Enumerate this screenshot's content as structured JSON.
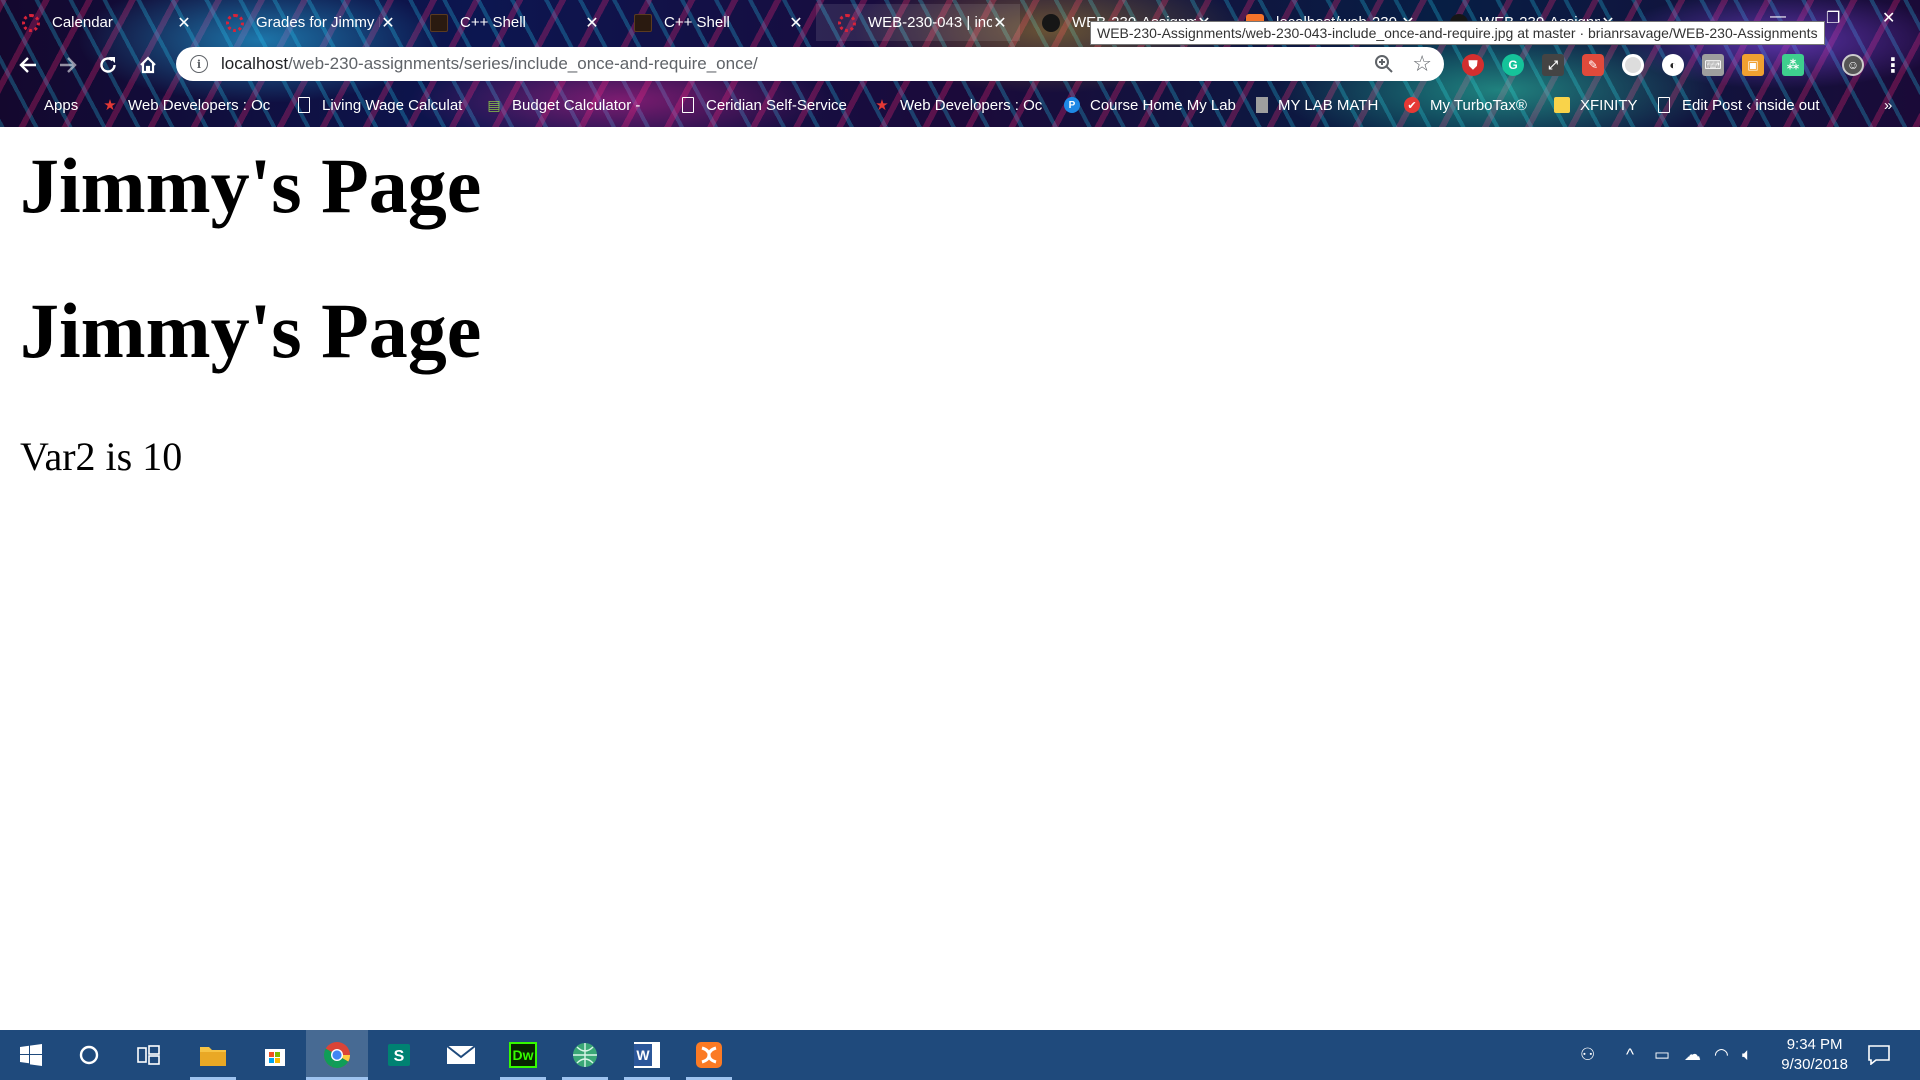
{
  "browser": {
    "tabs": [
      {
        "title": "Calendar",
        "icon": "ring-logo-icon",
        "active": false
      },
      {
        "title": "Grades for Jimmy I",
        "icon": "ring-logo-icon",
        "active": false
      },
      {
        "title": "C++ Shell",
        "icon": "cpp-shell-icon",
        "active": false
      },
      {
        "title": "C++ Shell",
        "icon": "cpp-shell-icon",
        "active": false
      },
      {
        "title": "WEB-230-043 | inc",
        "icon": "ring-logo-icon",
        "active": true
      },
      {
        "title": "WEB-230-Assignm",
        "icon": "github-icon",
        "active": false
      },
      {
        "title": "localhost/web-230",
        "icon": "xampp-icon",
        "active": false
      },
      {
        "title": "WEB-230-Assignm",
        "icon": "github-icon",
        "active": false
      }
    ],
    "tab_close_glyph": "✕",
    "tooltip": "WEB-230-Assignments/web-230-043-include_once-and-require.jpg at master · brianrsavage/WEB-230-Assignments",
    "address": {
      "host": "localhost",
      "path": "/web-230-assignments/series/include_once-and-require_once/"
    },
    "bookmarks": [
      {
        "label": "Apps",
        "icon": "apps-grid-icon"
      },
      {
        "label": "Web Developers : Oc",
        "icon": "red-star-icon"
      },
      {
        "label": "Living Wage Calculat",
        "icon": "page-icon"
      },
      {
        "label": "Budget Calculator - ",
        "icon": "calculator-icon"
      },
      {
        "label": "Ceridian Self-Service",
        "icon": "page-icon"
      },
      {
        "label": "Web Developers : Oc",
        "icon": "red-star-icon"
      },
      {
        "label": "Course Home My Lab",
        "icon": "pearson-icon"
      },
      {
        "label": "MY LAB MATH",
        "icon": "book-icon"
      },
      {
        "label": "My TurboTax®",
        "icon": "turbotax-check-icon"
      },
      {
        "label": "XFINITY",
        "icon": "folder-icon"
      },
      {
        "label": "Edit Post ‹ inside out",
        "icon": "page-icon"
      }
    ],
    "bookmarks_overflow": "»"
  },
  "page": {
    "heading_1": "Jimmy's Page",
    "heading_2": "Jimmy's Page",
    "text": "Var2 is 10"
  },
  "taskbar": {
    "apps": [
      {
        "name": "start-icon"
      },
      {
        "name": "cortana-search-icon"
      },
      {
        "name": "task-view-icon"
      },
      {
        "name": "file-explorer-icon"
      },
      {
        "name": "microsoft-store-icon"
      },
      {
        "name": "chrome-icon"
      },
      {
        "name": "sway-icon"
      },
      {
        "name": "mail-icon"
      },
      {
        "name": "dreamweaver-icon",
        "label": "Dw"
      },
      {
        "name": "globe-app-icon"
      },
      {
        "name": "word-icon",
        "label": "W"
      },
      {
        "name": "xampp-icon"
      }
    ],
    "clock_time": "9:34 PM",
    "clock_date": "9/30/2018"
  },
  "colors": {
    "taskbar": "#1f4a7c",
    "page_background": "#ffffff",
    "heading_text": "#000000"
  }
}
